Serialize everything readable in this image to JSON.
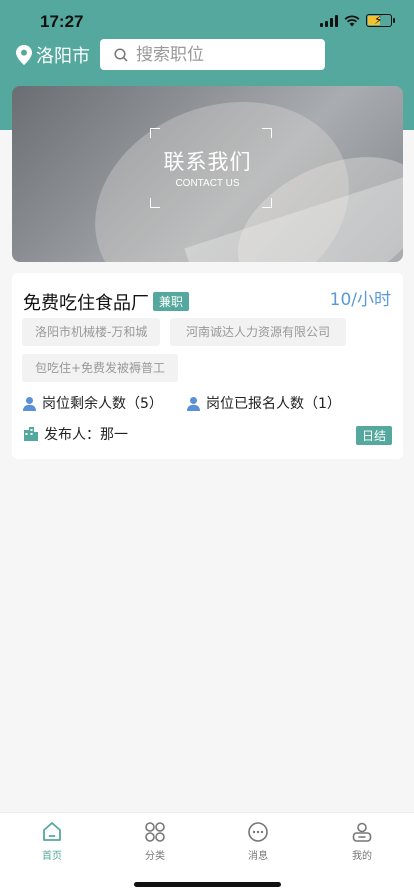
{
  "status_bar": {
    "time": "17:27"
  },
  "header": {
    "city": "洛阳市",
    "search_placeholder": "搜索职位"
  },
  "banner": {
    "title": "联系我们",
    "subtitle": "CONTACT US"
  },
  "job": {
    "title": "免费吃住食品厂",
    "type_tag": "兼职",
    "salary": "10/小时",
    "chips": [
      "洛阳市机械楼-万和城",
      "河南诚达人力资源有限公司",
      "包吃住+免费发被褥普工"
    ],
    "remaining": "岗位剩余人数（5）",
    "applied": "岗位已报名人数（1）",
    "publisher": "发布人：那一",
    "settlement": "日结"
  },
  "tabbar": {
    "items": [
      {
        "label": "首页",
        "icon": "home-icon"
      },
      {
        "label": "分类",
        "icon": "category-icon"
      },
      {
        "label": "消息",
        "icon": "message-icon"
      },
      {
        "label": "我的",
        "icon": "profile-icon"
      }
    ]
  },
  "colors": {
    "accent": "#54a89d",
    "salary": "#5b9bd5",
    "person_icon": "#5b8fd6"
  }
}
